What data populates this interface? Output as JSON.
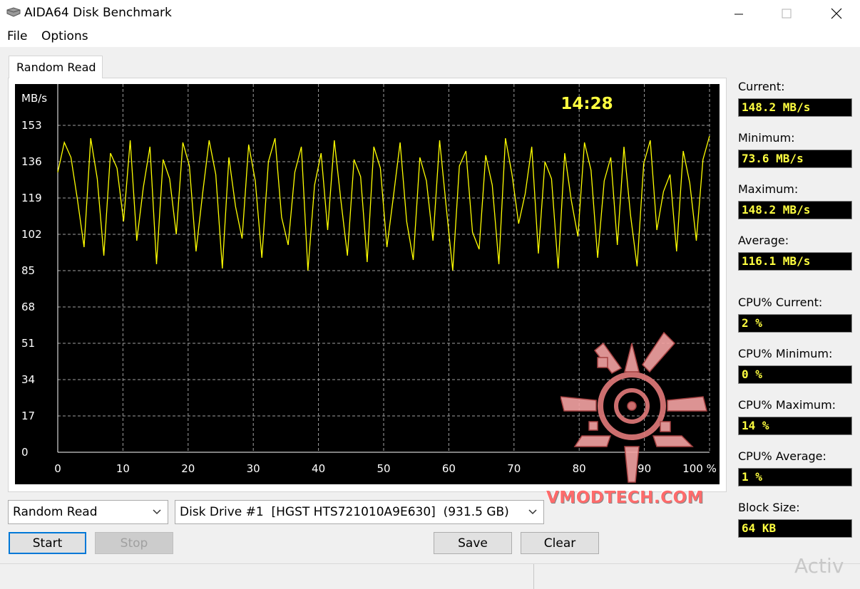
{
  "window": {
    "title": "AIDA64 Disk Benchmark",
    "minimize_icon": "minimize-icon",
    "maximize_icon": "maximize-icon",
    "close_icon": "close-icon"
  },
  "menu": {
    "items": [
      "File",
      "Options"
    ]
  },
  "tab": {
    "label": "Random Read"
  },
  "chart_data": {
    "type": "line",
    "ylabel": "MB/s",
    "timer": "14:28",
    "yticks": [
      "153",
      "136",
      "119",
      "102",
      "85",
      "68",
      "51",
      "34",
      "17",
      "0"
    ],
    "xticks": [
      "0",
      "10",
      "20",
      "30",
      "40",
      "50",
      "60",
      "70",
      "80",
      "90",
      "100 %"
    ],
    "ylim": [
      0,
      153
    ],
    "xlim": [
      0,
      100
    ],
    "grid": true,
    "line_color": "#ffff00",
    "series": [
      {
        "values": [
          131,
          145,
          138,
          118,
          96,
          147,
          128,
          92,
          140,
          133,
          108,
          146,
          99,
          124,
          143,
          88,
          137,
          128,
          102,
          145,
          134,
          94,
          121,
          146,
          130,
          86,
          138,
          115,
          100,
          144,
          127,
          91,
          136,
          147,
          110,
          97,
          131,
          143,
          85,
          125,
          140,
          104,
          146,
          118,
          92,
          137,
          129,
          89,
          143,
          133,
          96,
          120,
          145,
          108,
          90,
          138,
          127,
          99,
          146,
          115,
          85,
          134,
          141,
          103,
          95,
          139,
          125,
          88,
          147,
          130,
          107,
          121,
          143,
          93,
          136,
          128,
          86,
          140,
          118,
          101,
          145,
          132,
          91,
          127,
          138,
          97,
          143,
          111,
          87,
          135,
          146,
          104,
          122,
          130,
          94,
          141,
          126,
          99,
          137,
          148
        ]
      }
    ]
  },
  "stats": [
    {
      "label": "Current:",
      "value": "148.2 MB/s"
    },
    {
      "label": "Minimum:",
      "value": "73.6 MB/s"
    },
    {
      "label": "Maximum:",
      "value": "148.2 MB/s"
    },
    {
      "label": "Average:",
      "value": "116.1 MB/s"
    },
    {
      "label": "CPU% Current:",
      "value": "2 %"
    },
    {
      "label": "CPU% Minimum:",
      "value": "0 %"
    },
    {
      "label": "CPU% Maximum:",
      "value": "14 %"
    },
    {
      "label": "CPU% Average:",
      "value": "1 %"
    },
    {
      "label": "Block Size:",
      "value": "64 KB"
    }
  ],
  "controls": {
    "test_select": "Random Read",
    "drive_select": "Disk Drive #1  [HGST HTS721010A9E630]  (931.5 GB)",
    "start": "Start",
    "stop": "Stop",
    "save": "Save",
    "clear": "Clear"
  },
  "watermark": {
    "logo_text": "VMODTECH.COM",
    "os_text": "Activ"
  }
}
